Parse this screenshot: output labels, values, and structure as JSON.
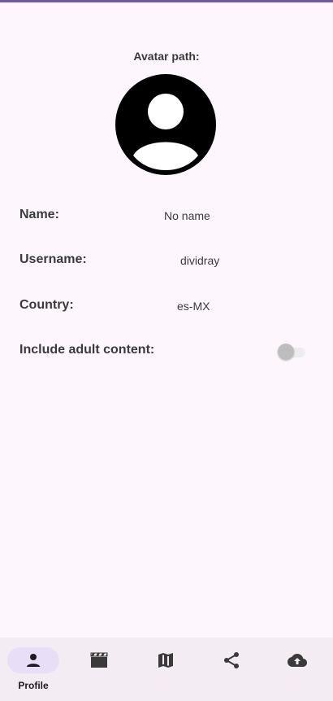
{
  "profile": {
    "avatar_label": "Avatar path:",
    "fields": [
      {
        "label": "Name:",
        "value": "No name"
      },
      {
        "label": "Username:",
        "value": "dividray"
      },
      {
        "label": "Country:",
        "value": "es-MX"
      }
    ],
    "adult_content": {
      "label": "Include adult content:",
      "enabled": false
    }
  },
  "bottom_nav": {
    "items": [
      {
        "label": "Profile",
        "icon": "person-icon",
        "active": true
      },
      {
        "label": "",
        "icon": "movie-icon",
        "active": false
      },
      {
        "label": "",
        "icon": "map-icon",
        "active": false
      },
      {
        "label": "",
        "icon": "share-icon",
        "active": false
      },
      {
        "label": "",
        "icon": "cloud-upload-icon",
        "active": false
      }
    ]
  },
  "colors": {
    "background": "#fdf7fd",
    "accent": "#6a5ba8",
    "nav_background": "#f3edf3",
    "active_pill": "#e8def8"
  }
}
